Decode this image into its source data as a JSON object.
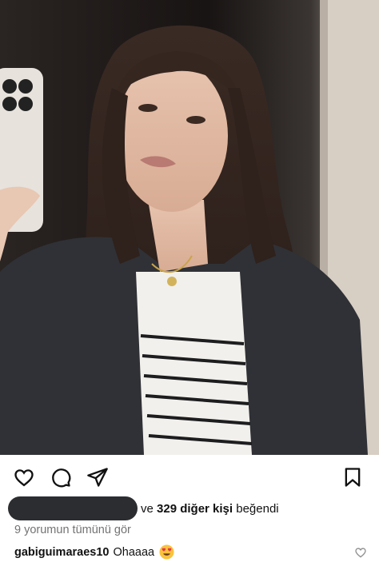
{
  "post": {
    "likes": {
      "connector": "ve",
      "count_text": "329 diğer kişi",
      "suffix": "beğendi"
    },
    "view_comments": "9 yorumun tümünü gör",
    "caption": {
      "username": "gabiguimaraes10",
      "text": "Ohaaaa",
      "emoji": "heart-eyes-emoji"
    }
  },
  "icons": {
    "like": "heart-icon",
    "comment": "comment-bubble-icon",
    "share": "paper-plane-icon",
    "save": "bookmark-icon",
    "comment_like": "small-heart-icon"
  }
}
